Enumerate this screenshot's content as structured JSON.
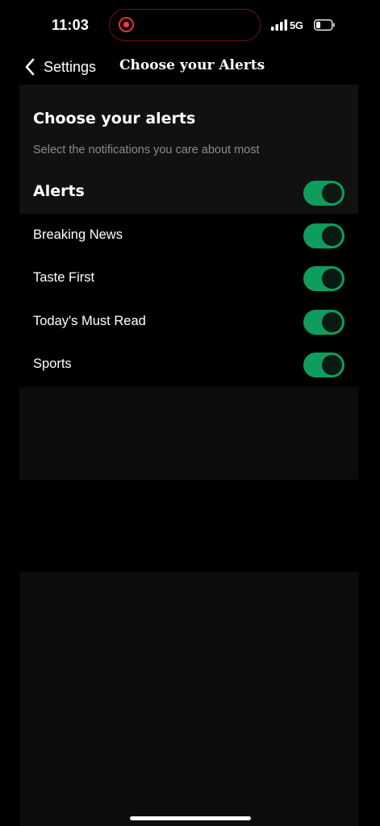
{
  "status_bar": {
    "time": "11:03",
    "network": "5G",
    "signal_icon": "cellular-signal-icon",
    "battery_icon": "battery-icon",
    "recording_icon": "screen-recording-icon"
  },
  "nav": {
    "back_label": "Settings",
    "title": "Choose your Alerts"
  },
  "header": {
    "title": "Choose your alerts",
    "subtitle": "Select the notifications you care about most",
    "master_label": "Alerts",
    "master_enabled": true
  },
  "alerts": [
    {
      "label": "Breaking News",
      "enabled": true
    },
    {
      "label": "Taste First",
      "enabled": true
    },
    {
      "label": "Today's Must Read",
      "enabled": true
    },
    {
      "label": "Sports",
      "enabled": true
    }
  ],
  "colors": {
    "background": "#000000",
    "card": "#111111",
    "toggle_on": "#0e9d5c",
    "subtitle_text": "#8a8a8a",
    "recording_red": "#ff3b3b"
  }
}
